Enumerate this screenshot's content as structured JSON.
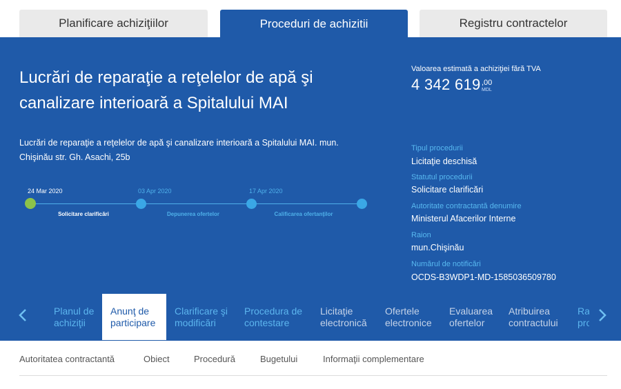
{
  "top_tabs": [
    "Planificare achiziţiilor",
    "Proceduri de achizitii",
    "Registru contractelor"
  ],
  "procedure": {
    "title_line1": "Lucrări de reparaţie a reţelelor de apă şi",
    "title_line2": "canalizare interioară a Spitalului MAI",
    "description_line1": "Lucrări de reparaţie a reţelelor de apă şi canalizare interioară a Spitalului MAI. mun.",
    "description_line2": "Chişinău str. Gh. Asachi, 25b"
  },
  "estimate": {
    "label": "Valoarea estimată a achiziţiei fără TVA",
    "value": "4 342 619",
    "cents": ",00",
    "currency": "MDL"
  },
  "timeline": {
    "dates": [
      "24 Mar 2020",
      "03 Apr 2020",
      "17 Apr 2020"
    ],
    "steps": [
      "Solicitare clarificări",
      "Depunerea ofertelor",
      "Calificarea ofertanţilor"
    ]
  },
  "info": {
    "type_label": "Tipul procedurii",
    "type_value": "Licitaţie deschisă",
    "status_label": "Statutul procedurii",
    "status_value": "Solicitare clarificări",
    "authority_label": "Autoritate contractantă denumire",
    "authority_value": "Ministerul Afacerilor Interne",
    "district_label": "Raion",
    "district_value": "mun.Chişinău",
    "notice_label": "Numărul de notificări",
    "notice_value": "OCDS-B3WDP1-MD-1585036509780"
  },
  "section_nav": {
    "prev_icon": "chevron-left-icon",
    "next_icon": "chevron-right-icon",
    "items": [
      {
        "line1": "Planul de",
        "line2": "achiziţii"
      },
      {
        "line1": "Anunţ de",
        "line2": "participare"
      },
      {
        "line1": "Clarificare şi",
        "line2": "modificări"
      },
      {
        "line1": "Procedura de",
        "line2": "contestare"
      },
      {
        "line1": "Licitaţie",
        "line2": "electronică"
      },
      {
        "line1": "Ofertele",
        "line2": "electronice"
      },
      {
        "line1": "Evaluarea",
        "line2": "ofertelor"
      },
      {
        "line1": "Atribuirea",
        "line2": "contractului"
      },
      {
        "line1": "Ra",
        "line2": "pro"
      }
    ]
  },
  "sub_tabs": [
    "Autoritatea contractantă",
    "Obiect",
    "Procedură",
    "Bugetului",
    "Informaţii complementare"
  ],
  "colors": {
    "primary": "#1f5aa9",
    "accent": "#3aa7e6",
    "done": "#8cc34a"
  }
}
